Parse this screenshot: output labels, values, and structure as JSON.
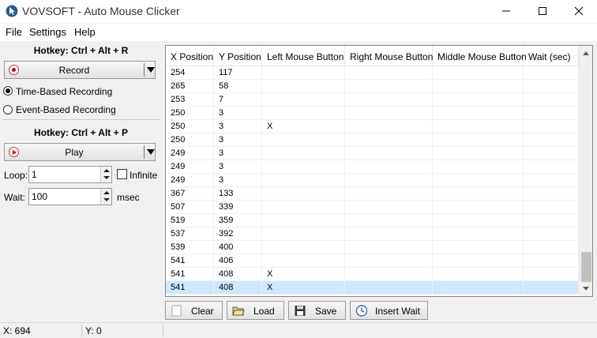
{
  "window": {
    "title": "VOVSOFT - Auto Mouse Clicker"
  },
  "menu": [
    "File",
    "Settings",
    "Help"
  ],
  "record": {
    "hotkey": "Hotkey: Ctrl + Alt + R",
    "button_label": "Record",
    "mode_time": "Time-Based Recording",
    "mode_event": "Event-Based Recording",
    "selected_mode": "Time-Based Recording"
  },
  "play": {
    "hotkey": "Hotkey: Ctrl + Alt + P",
    "button_label": "Play",
    "loop_label": "Loop:",
    "loop_value": "1",
    "infinite_label": "Infinite",
    "infinite_checked": false,
    "wait_label": "Wait:",
    "wait_value": "100",
    "wait_unit": "msec"
  },
  "table": {
    "columns": [
      "X Position",
      "Y Position",
      "Left Mouse Button",
      "Right Mouse Button",
      "Middle Mouse Button",
      "Wait (sec)"
    ],
    "rows": [
      [
        "254",
        "117",
        "",
        "",
        "",
        ""
      ],
      [
        "265",
        "58",
        "",
        "",
        "",
        ""
      ],
      [
        "253",
        "7",
        "",
        "",
        "",
        ""
      ],
      [
        "250",
        "3",
        "",
        "",
        "",
        ""
      ],
      [
        "250",
        "3",
        "X",
        "",
        "",
        ""
      ],
      [
        "250",
        "3",
        "",
        "",
        "",
        ""
      ],
      [
        "249",
        "3",
        "",
        "",
        "",
        ""
      ],
      [
        "249",
        "3",
        "",
        "",
        "",
        ""
      ],
      [
        "249",
        "3",
        "",
        "",
        "",
        ""
      ],
      [
        "367",
        "133",
        "",
        "",
        "",
        ""
      ],
      [
        "507",
        "339",
        "",
        "",
        "",
        ""
      ],
      [
        "519",
        "359",
        "",
        "",
        "",
        ""
      ],
      [
        "537",
        "392",
        "",
        "",
        "",
        ""
      ],
      [
        "539",
        "400",
        "",
        "",
        "",
        ""
      ],
      [
        "541",
        "406",
        "",
        "",
        "",
        ""
      ],
      [
        "541",
        "408",
        "X",
        "",
        "",
        ""
      ],
      [
        "541",
        "408",
        "X",
        "",
        "",
        ""
      ]
    ],
    "selected_row": 16
  },
  "actions": {
    "clear": "Clear",
    "load": "Load",
    "save": "Save",
    "insert_wait": "Insert Wait"
  },
  "status": {
    "x": "X: 694",
    "y": "Y: 0"
  },
  "colors": {
    "selection": "#cce8ff",
    "record_red": "#cc0000"
  }
}
